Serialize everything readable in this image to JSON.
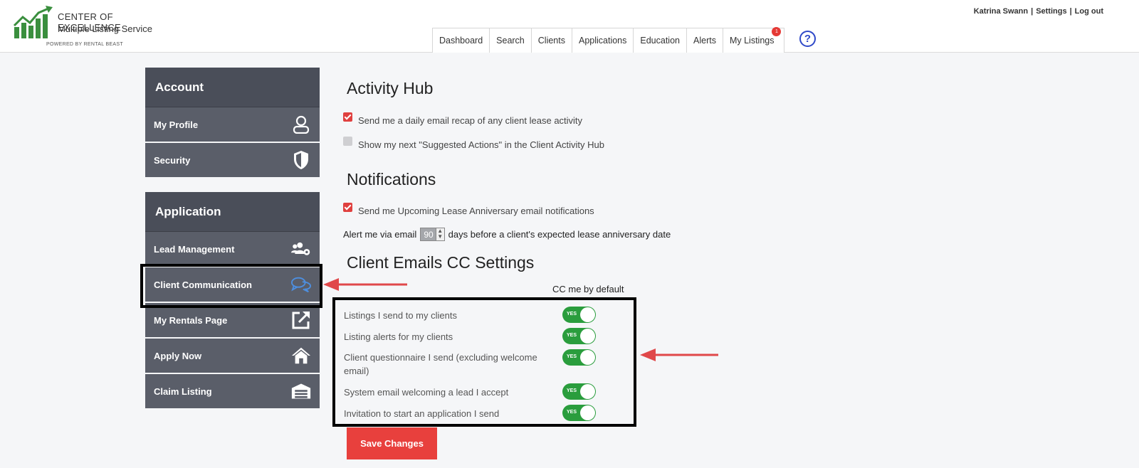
{
  "brand": {
    "line1": "CENTER OF  EXCELLENCE",
    "line2": "Multiple Listing  Service",
    "line3": "POWERED BY RENTAL BEAST",
    "accent": "#3a8f3e"
  },
  "user": {
    "name": "Katrina Swann",
    "settings": "Settings",
    "logout": "Log out",
    "separator": "|"
  },
  "nav": {
    "items": [
      "Dashboard",
      "Search",
      "Clients",
      "Applications",
      "Education",
      "Alerts",
      "My Listings"
    ],
    "my_listings_badge": "1",
    "help_symbol": "?"
  },
  "sidebar": {
    "account_heading": "Account",
    "account_items": [
      {
        "label": "My Profile",
        "icon": "user-icon"
      },
      {
        "label": "Security",
        "icon": "shield-icon"
      }
    ],
    "application_heading": "Application",
    "application_items": [
      {
        "label": "Lead Management",
        "icon": "users-gear-icon"
      },
      {
        "label": "Client Communication",
        "icon": "chat-bubbles-icon"
      },
      {
        "label": "My Rentals Page",
        "icon": "external-link-icon"
      },
      {
        "label": "Apply Now",
        "icon": "home-icon"
      },
      {
        "label": "Claim Listing",
        "icon": "garage-icon"
      }
    ],
    "active_item": "Client Communication"
  },
  "activity_hub": {
    "title": "Activity Hub",
    "options": [
      {
        "label": "Send me a daily email recap of any client lease activity",
        "checked": true
      },
      {
        "label": "Show my next \"Suggested Actions\" in the Client Activity Hub",
        "checked": false
      }
    ]
  },
  "notifications": {
    "title": "Notifications",
    "option": {
      "label": "Send me Upcoming Lease Anniversary email notifications",
      "checked": true
    },
    "alert_prefix": "Alert me via email",
    "alert_days": "90",
    "alert_suffix": "days before a client's expected lease anniversary date"
  },
  "cc_settings": {
    "title": "Client Emails CC Settings",
    "column_header": "CC me by default",
    "toggle_text": "YES",
    "rows": [
      {
        "label": "Listings I send to my clients",
        "value": true
      },
      {
        "label": "Listing alerts for my clients",
        "value": true
      },
      {
        "label": "Client questionnaire I send (excluding welcome email)",
        "value": true
      },
      {
        "label": "System email welcoming a lead I accept",
        "value": true
      },
      {
        "label": "Invitation to start an application I send",
        "value": true
      }
    ]
  },
  "actions": {
    "save_label": "Save Changes"
  },
  "colors": {
    "sidebar_head": "#4a4e59",
    "sidebar_item": "#5a5e69",
    "toggle_on": "#2a9d3d",
    "primary_button": "#e8403d",
    "annotation_arrow": "#e0484a"
  }
}
